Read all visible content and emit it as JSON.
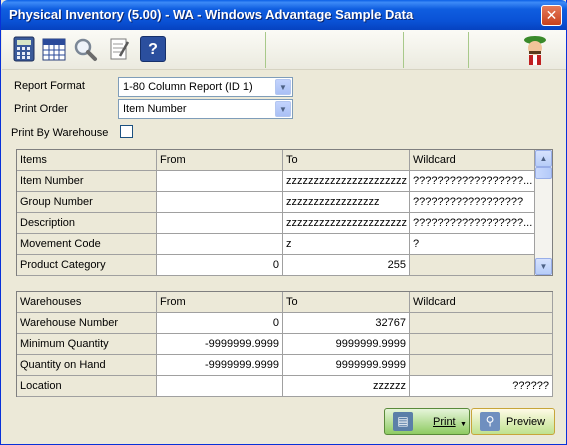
{
  "window": {
    "title": "Physical Inventory (5.00) - WA - Windows Advantage Sample Data",
    "close_symbol": "✕"
  },
  "toolbar": {
    "icons": [
      "calculator-icon",
      "calendar-icon",
      "magnifier-icon",
      "notepad-icon",
      "help-book-icon",
      "mascot-icon"
    ],
    "help_glyph": "?"
  },
  "form": {
    "report_format_label": "Report Format",
    "report_format_value": "1-80 Column Report (ID 1)",
    "print_order_label": "Print Order",
    "print_order_value": "Item Number",
    "print_by_warehouse_label": "Print By Warehouse",
    "print_by_warehouse_checked": false
  },
  "items_grid": {
    "headers": [
      "Items",
      "From",
      "To",
      "Wildcard"
    ],
    "rows": [
      {
        "label": "Item Number",
        "from": "",
        "to": "zzzzzzzzzzzzzzzzzzzzzz",
        "wildcard": "??????????????????..."
      },
      {
        "label": "Group Number",
        "from": "",
        "to": "zzzzzzzzzzzzzzzzz",
        "wildcard": "??????????????????"
      },
      {
        "label": "Description",
        "from": "",
        "to": "zzzzzzzzzzzzzzzzzzzzzz",
        "wildcard": "??????????????????..."
      },
      {
        "label": "Movement Code",
        "from": "",
        "to": "z",
        "wildcard": "?"
      },
      {
        "label": "Product Category",
        "from": "0",
        "to": "255",
        "wildcard": ""
      }
    ]
  },
  "warehouses_grid": {
    "headers": [
      "Warehouses",
      "From",
      "To",
      "Wildcard"
    ],
    "rows": [
      {
        "label": "Warehouse Number",
        "from": "0",
        "to": "32767",
        "wildcard": ""
      },
      {
        "label": "Minimum Quantity",
        "from": "-9999999.9999",
        "to": "9999999.9999",
        "wildcard": ""
      },
      {
        "label": "Quantity on Hand",
        "from": "-9999999.9999",
        "to": "9999999.9999",
        "wildcard": ""
      },
      {
        "label": "Location",
        "from": "",
        "to": "zzzzzz",
        "wildcard": "??????"
      }
    ]
  },
  "buttons": {
    "print_label": "Print",
    "preview_label": "Preview"
  }
}
